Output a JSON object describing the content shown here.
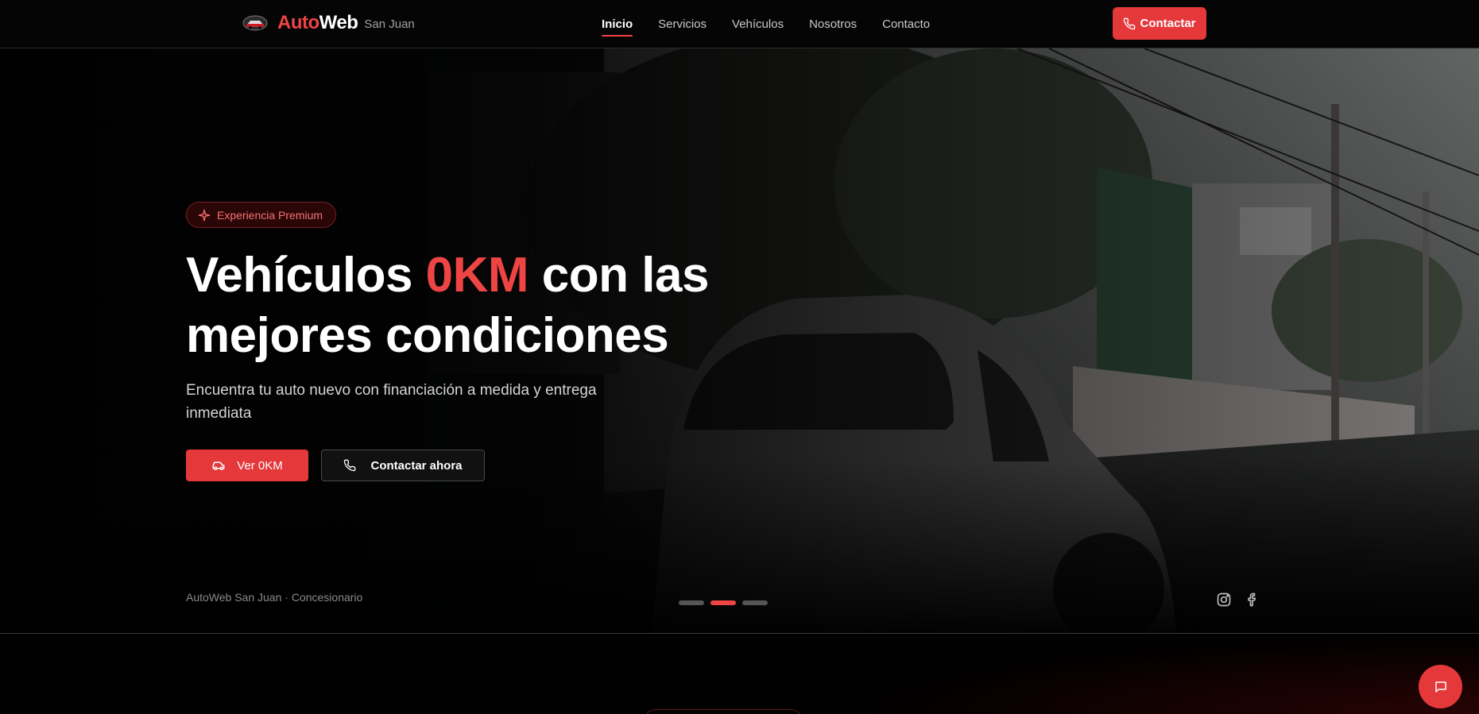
{
  "nav": {
    "brand_prefix": "Auto",
    "brand_suffix": "Web",
    "brand_city": "San Juan",
    "links": [
      {
        "label": "Inicio",
        "active": true
      },
      {
        "label": "Servicios",
        "active": false
      },
      {
        "label": "Vehículos",
        "active": false
      },
      {
        "label": "Nosotros",
        "active": false
      },
      {
        "label": "Contacto",
        "active": false
      }
    ],
    "cta_label": "Contactar"
  },
  "hero": {
    "badge": "Experiencia Premium",
    "headline_part1": "Vehículos ",
    "headline_accent": "0KM",
    "headline_part2": " con las mejores condiciones",
    "subtitle": "Encuentra tu auto nuevo con financiación a medida y entrega inmediata",
    "primary_button": "Ver 0KM",
    "secondary_button": "Contactar ahora",
    "footer_note": "AutoWeb San Juan · Concesionario",
    "carousel": {
      "slides": 3,
      "active_index": 1
    },
    "social_icons": [
      "instagram-icon",
      "facebook-icon"
    ]
  },
  "chat": {
    "icon": "chat-icon"
  },
  "colors": {
    "accent": "#ef4444",
    "button": "#e5383b",
    "background": "#000000"
  }
}
